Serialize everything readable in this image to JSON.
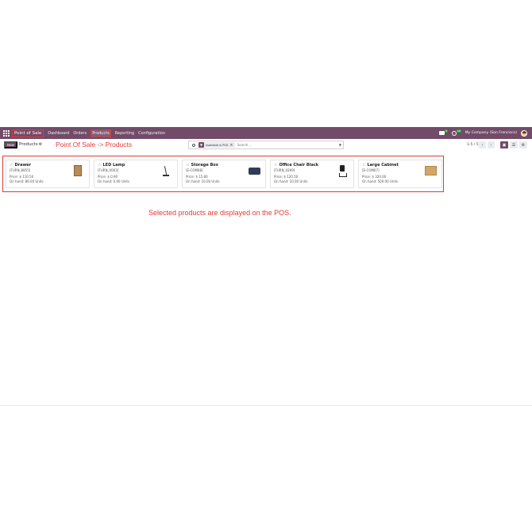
{
  "topbar": {
    "app_name": "Point of Sale",
    "menu": [
      "Dashboard",
      "Orders",
      "Products",
      "Reporting",
      "Configuration"
    ],
    "chat_badge": "9",
    "activity_badge": "29",
    "company": "My Company (San Francisco)"
  },
  "controlbar": {
    "new_label": "New",
    "breadcrumb": "Products",
    "search_facet": "Available in POS",
    "search_placeholder": "Search...",
    "pager": "1-5 / 5"
  },
  "annotations": {
    "title": "Point Of Sale -> Products",
    "message": "Selected products are displayed on the POS."
  },
  "products": [
    {
      "name": "Drawer",
      "code": "[FURN_8855]",
      "price": "Price: $ 110.50",
      "onhand": "On hand: 89.00 Units",
      "image": "drawer"
    },
    {
      "name": "LED Lamp",
      "code": "[FURN_0003]",
      "price": "Price: $ 0.90",
      "onhand": "On hand: 0.00 Units",
      "image": "lamp"
    },
    {
      "name": "Storage Box",
      "code": "[E-COM08]",
      "price": "Price: $ 15.80",
      "onhand": "On hand: 10.00 Units",
      "image": "storage-box"
    },
    {
      "name": "Office Chair Black",
      "code": "[FURN_0269]",
      "price": "Price: $ 120.50",
      "onhand": "On hand: 10.00 Units",
      "image": "office-chair"
    },
    {
      "name": "Large Cabinet",
      "code": "[E-COM07]",
      "price": "Price: $ 320.00",
      "onhand": "On hand: 500.00 Units",
      "image": "cabinet"
    }
  ],
  "colors": {
    "brand": "#714b67",
    "annotation": "#e53935"
  }
}
